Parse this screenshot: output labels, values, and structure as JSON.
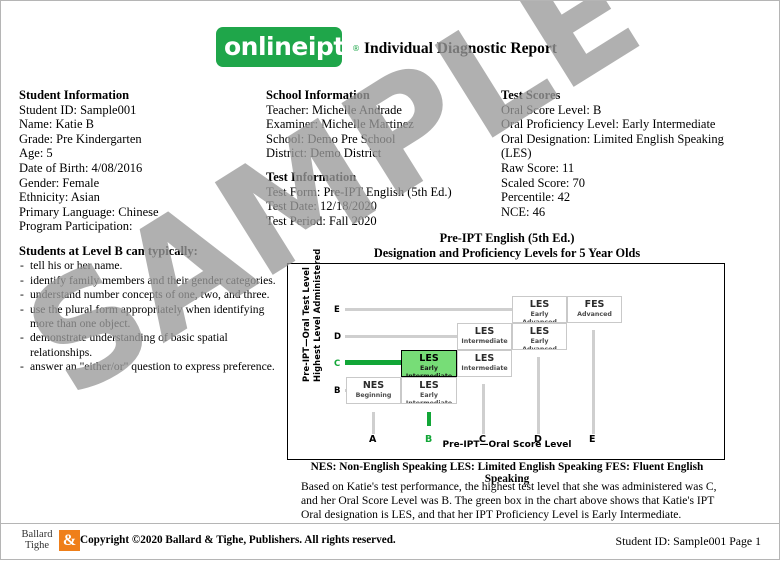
{
  "header": {
    "logo_text": "onlineipt",
    "logo_registered": "®",
    "logo_color": "#1fa64a",
    "report_title": "Individual Diagnostic Report"
  },
  "student_information": {
    "heading": "Student Information",
    "lines": [
      "Student ID: Sample001",
      "Name: Katie B",
      "Grade: Pre Kindergarten",
      "Age: 5",
      "Date of Birth: 4/08/2016",
      "Gender: Female",
      "Ethnicity: Asian",
      "Primary Language: Chinese",
      "Program Participation:"
    ]
  },
  "school_information": {
    "heading": "School Information",
    "lines": [
      "Teacher: Michelle Andrade",
      "Examiner: Michelle Martinez",
      "School: Demo Pre School",
      "District: Demo District"
    ]
  },
  "test_information": {
    "heading": "Test Information",
    "lines": [
      "Test Form: Pre-IPT English (5th Ed.)",
      "Test Date: 12/18/2020",
      "Test Period: Fall 2020"
    ]
  },
  "test_scores": {
    "heading": "Test Scores",
    "lines": [
      "Oral Score Level: B",
      "Oral Proficiency Level: Early Intermediate",
      "Oral Designation: Limited English Speaking",
      "(LES)",
      "Raw Score: 11",
      "Scaled Score: 70",
      "Percentile: 42",
      "NCE: 46"
    ]
  },
  "level_description": {
    "heading": "Students at Level B can typically:",
    "items": [
      "tell his or her name.",
      "identify family members and their gender categories.",
      "understand number concepts of one, two, and three.",
      "use the plural form appropriately when identifying more than one object.",
      "demonstrate understanding of basic spatial relationships.",
      "answer an \"either/or\" question to express preference."
    ]
  },
  "chart_data": {
    "type": "heatmap",
    "title": "Pre-IPT English (5th Ed.)",
    "subtitle": "Designation and Proficiency Levels for 5 Year Olds",
    "xlabel": "Pre-IPT—Oral Score Level",
    "ylabel_1": "Pre-IPT—Oral Test Level",
    "ylabel_2": "Highest Level Administered",
    "categories": [
      "A",
      "B",
      "C",
      "D",
      "E"
    ],
    "y_categories": [
      "B",
      "C",
      "D",
      "E"
    ],
    "highlight": {
      "x": "B",
      "y": "C",
      "color": "#77dd77",
      "designation": "LES",
      "proficiency": "Early Intermediate"
    },
    "cells": [
      {
        "x": "A",
        "y": "B",
        "designation": "NES",
        "proficiency": "Beginning",
        "highlight": false
      },
      {
        "x": "B",
        "y": "B",
        "designation": "LES",
        "proficiency": "Early Intermediate",
        "highlight": false
      },
      {
        "x": "B",
        "y": "C",
        "designation": "LES",
        "proficiency": "Early Intermediate",
        "highlight": true
      },
      {
        "x": "C",
        "y": "C",
        "designation": "LES",
        "proficiency": "Intermediate",
        "highlight": false
      },
      {
        "x": "C",
        "y": "D",
        "designation": "LES",
        "proficiency": "Intermediate",
        "highlight": false
      },
      {
        "x": "D",
        "y": "D",
        "designation": "LES",
        "proficiency": "Early Advanced",
        "highlight": false
      },
      {
        "x": "D",
        "y": "E",
        "designation": "LES",
        "proficiency": "Early Advanced",
        "highlight": false
      },
      {
        "x": "E",
        "y": "E",
        "designation": "FES",
        "proficiency": "Advanced",
        "highlight": false
      }
    ],
    "grid": false,
    "legend_position": "below"
  },
  "chart_legend": "NES: Non-English Speaking   LES: Limited English Speaking   FES: Fluent English Speaking",
  "chart_note": "Based on Katie's test performance, the highest test level that she was administered was C, and her Oral Score Level was B. The green box in the chart above shows that Katie's IPT Oral designation is LES, and that her IPT Proficiency Level is Early Intermediate.",
  "footer": {
    "publisher_line1": "Ballard",
    "publisher_line2": "Tighe",
    "publisher_mark": "&",
    "publisher_mark_color": "#ef7f1a",
    "copyright": "Copyright ©2020 Ballard & Tighe, Publishers. All rights reserved.",
    "right": "Student ID: Sample001   Page 1"
  },
  "watermark": {
    "text": "SAMPLE",
    "color": "#9a9a9a"
  }
}
